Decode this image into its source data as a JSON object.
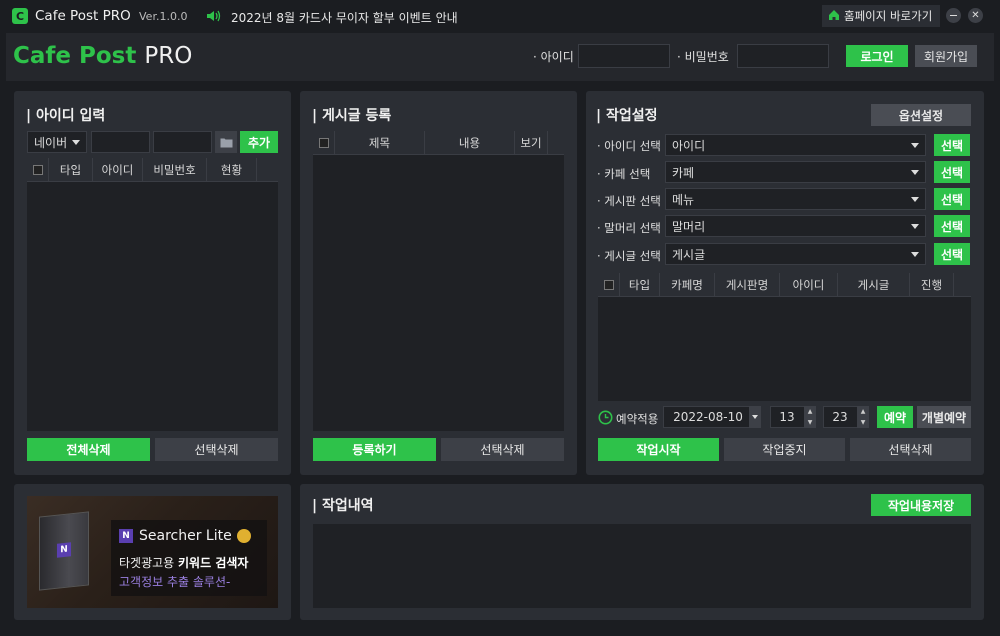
{
  "titlebar": {
    "app_name": "Cafe Post PRO",
    "version": "Ver.1.0.0",
    "notice": "2022년 8월 카드사 무이자 할부 이벤트 안내",
    "homepage_label": "홈페이지 바로가기"
  },
  "header": {
    "logo_part1": "Cafe Post",
    "logo_part2": "PRO",
    "id_label": "· 아이디",
    "pw_label": "· 비밀번호",
    "login_label": "로그인",
    "signup_label": "회원가입"
  },
  "id_panel": {
    "title": "| 아이디 입력",
    "platform": "네이버",
    "add_label": "추가",
    "columns": [
      "타입",
      "아이디",
      "비밀번호",
      "현황"
    ],
    "delete_all_label": "전체삭제",
    "delete_selected_label": "선택삭제"
  },
  "post_panel": {
    "title": "| 게시글 등록",
    "columns": [
      "제목",
      "내용",
      "보기"
    ],
    "register_label": "등록하기",
    "delete_selected_label": "선택삭제"
  },
  "work_panel": {
    "title": "| 작업설정",
    "options_label": "옵션설정",
    "rows": [
      {
        "label": "· 아이디 선택",
        "value": "아이디",
        "btn": "선택"
      },
      {
        "label": "· 카페 선택",
        "value": "카페",
        "btn": "선택"
      },
      {
        "label": "· 게시판 선택",
        "value": "메뉴",
        "btn": "선택"
      },
      {
        "label": "· 말머리 선택",
        "value": "말머리",
        "btn": "선택"
      },
      {
        "label": "· 게시글 선택",
        "value": "게시글",
        "btn": "선택"
      }
    ],
    "columns": [
      "타입",
      "카페명",
      "게시판명",
      "아이디",
      "게시글",
      "진행"
    ],
    "schedule_label": "예약적용",
    "date": "2022-08-10",
    "hour": "13",
    "minute": "23",
    "reserve_label": "예약",
    "individual_reserve_label": "개별예약",
    "start_label": "작업시작",
    "stop_label": "작업중지",
    "delete_selected_label": "선택삭제"
  },
  "ad": {
    "brand_n": "N",
    "brand_name": "Searcher Lite",
    "line1_normal": "타겟광고용 ",
    "line1_bold": "키워드 검색자",
    "line2": "고객정보 추출 솔루션-"
  },
  "log_panel": {
    "title": "| 작업내역",
    "save_label": "작업내용저장"
  },
  "colors": {
    "accent": "#2ec24a",
    "background": "#1b1d21",
    "panel": "#2b2e34"
  }
}
